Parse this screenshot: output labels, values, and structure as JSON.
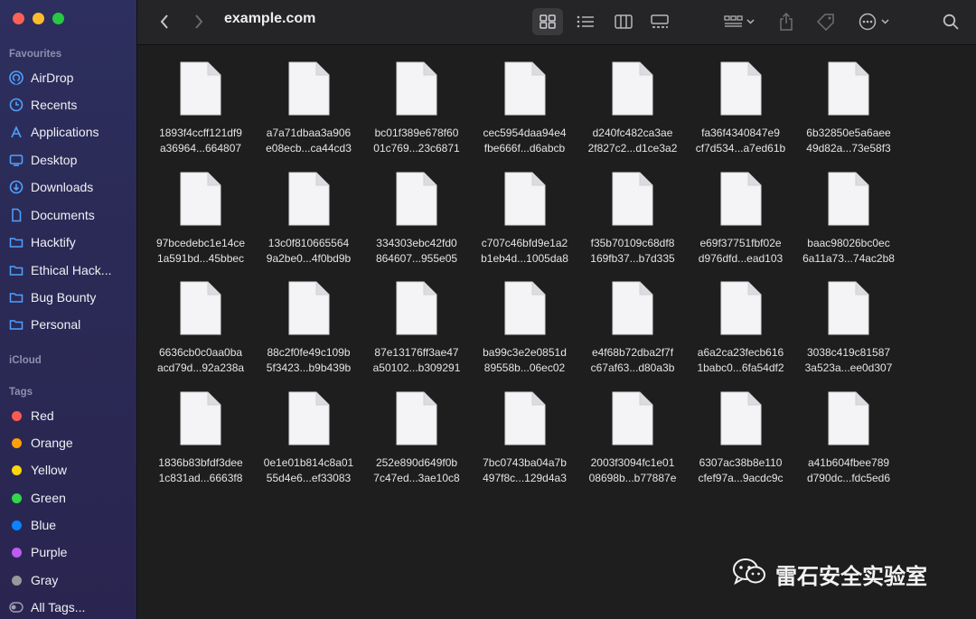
{
  "window": {
    "path_title": "example.com"
  },
  "sidebar": {
    "sections": {
      "favourites": "Favourites",
      "icloud": "iCloud",
      "tags": "Tags"
    },
    "favourites": [
      {
        "label": "AirDrop",
        "icon": "airdrop-icon"
      },
      {
        "label": "Recents",
        "icon": "clock-icon"
      },
      {
        "label": "Applications",
        "icon": "applications-icon"
      },
      {
        "label": "Desktop",
        "icon": "desktop-icon"
      },
      {
        "label": "Downloads",
        "icon": "download-icon"
      },
      {
        "label": "Documents",
        "icon": "document-icon"
      },
      {
        "label": "Hacktify",
        "icon": "folder-icon"
      },
      {
        "label": "Ethical Hack...",
        "icon": "folder-icon"
      },
      {
        "label": "Bug Bounty",
        "icon": "folder-icon"
      },
      {
        "label": "Personal",
        "icon": "folder-icon"
      }
    ],
    "tags": [
      {
        "label": "Red",
        "color": "#ff5a52"
      },
      {
        "label": "Orange",
        "color": "#ff9f0a"
      },
      {
        "label": "Yellow",
        "color": "#ffd60a"
      },
      {
        "label": "Green",
        "color": "#32d74b"
      },
      {
        "label": "Blue",
        "color": "#0a84ff"
      },
      {
        "label": "Purple",
        "color": "#bf5af2"
      },
      {
        "label": "Gray",
        "color": "#98989d"
      },
      {
        "label": "All Tags...",
        "color": "all-tags-icon"
      }
    ]
  },
  "files": [
    {
      "line1": "1893f4ccff121df9",
      "line2": "a36964...664807"
    },
    {
      "line1": "a7a71dbaa3a906",
      "line2": "e08ecb...ca44cd3"
    },
    {
      "line1": "bc01f389e678f60",
      "line2": "01c769...23c6871"
    },
    {
      "line1": "cec5954daa94e4",
      "line2": "fbe666f...d6abcb"
    },
    {
      "line1": "d240fc482ca3ae",
      "line2": "2f827c2...d1ce3a2"
    },
    {
      "line1": "fa36f4340847e9",
      "line2": "cf7d534...a7ed61b"
    },
    {
      "line1": "6b32850e5a6aee",
      "line2": "49d82a...73e58f3"
    },
    {
      "line1": "97bcedebc1e14ce",
      "line2": "1a591bd...45bbec"
    },
    {
      "line1": "13c0f810665564",
      "line2": "9a2be0...4f0bd9b"
    },
    {
      "line1": "334303ebc42fd0",
      "line2": "864607...955e05"
    },
    {
      "line1": "c707c46bfd9e1a2",
      "line2": "b1eb4d...1005da8"
    },
    {
      "line1": "f35b70109c68df8",
      "line2": "169fb37...b7d335"
    },
    {
      "line1": "e69f37751fbf02e",
      "line2": "d976dfd...ead103"
    },
    {
      "line1": "baac98026bc0ec",
      "line2": "6a11a73...74ac2b8"
    },
    {
      "line1": "6636cb0c0aa0ba",
      "line2": "acd79d...92a238a"
    },
    {
      "line1": "88c2f0fe49c109b",
      "line2": "5f3423...b9b439b"
    },
    {
      "line1": "87e13176ff3ae47",
      "line2": "a50102...b309291"
    },
    {
      "line1": "ba99c3e2e0851d",
      "line2": "89558b...06ec02"
    },
    {
      "line1": "e4f68b72dba2f7f",
      "line2": "c67af63...d80a3b"
    },
    {
      "line1": "a6a2ca23fecb616",
      "line2": "1babc0...6fa54df2"
    },
    {
      "line1": "3038c419c81587",
      "line2": "3a523a...ee0d307"
    },
    {
      "line1": "1836b83bfdf3dee",
      "line2": "1c831ad...6663f8"
    },
    {
      "line1": "0e1e01b814c8a01",
      "line2": "55d4e6...ef33083"
    },
    {
      "line1": "252e890d649f0b",
      "line2": "7c47ed...3ae10c8"
    },
    {
      "line1": "7bc0743ba04a7b",
      "line2": "497f8c...129d4a3"
    },
    {
      "line1": "2003f3094fc1e01",
      "line2": "08698b...b77887e"
    },
    {
      "line1": "6307ac38b8e110",
      "line2": "cfef97a...9acdc9c"
    },
    {
      "line1": "a41b604fbee789",
      "line2": "d790dc...fdc5ed6"
    }
  ],
  "watermark": {
    "text": "雷石安全实验室",
    "icon": "wechat-icon"
  }
}
